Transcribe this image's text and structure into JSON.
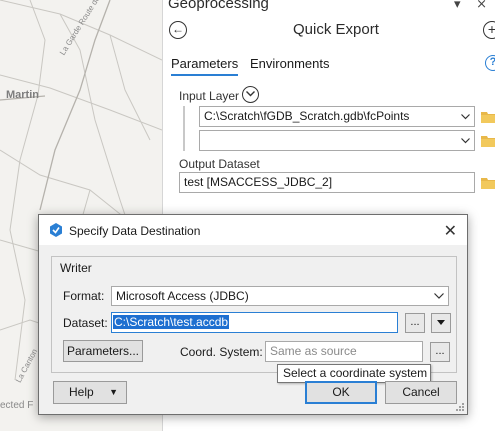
{
  "map": {
    "labels": {
      "martin": "Martin",
      "road_top": "La Garde Route de Ro",
      "road_bottom": "La Canton",
      "attribution": "ected F"
    }
  },
  "geoprocessing": {
    "pane_title": "Geoprocessing",
    "pane_controls": "▾ ⨯",
    "tool_title": "Quick Export",
    "tabs": [
      "Parameters",
      "Environments"
    ],
    "active_tab": "Parameters",
    "input_layer": {
      "label": "Input Layer",
      "rows": [
        "C:\\Scratch\\fGDB_Scratch.gdb\\fcPoints",
        ""
      ]
    },
    "output_dataset": {
      "label": "Output Dataset",
      "value": "test [MSACCESS_JDBC_2]"
    }
  },
  "dialog": {
    "title": "Specify Data Destination",
    "group_label": "Writer",
    "format": {
      "label": "Format:",
      "value": "Microsoft Access (JDBC)"
    },
    "dataset": {
      "label": "Dataset:",
      "value": "C:\\Scratch\\test.accdb",
      "browse": "..."
    },
    "parameters_button": "Parameters...",
    "coord_system": {
      "label": "Coord. System:",
      "placeholder": "Same as source",
      "browse": "..."
    },
    "tooltip": "Select a coordinate system",
    "buttons": {
      "help": "Help",
      "ok": "OK",
      "cancel": "Cancel"
    }
  },
  "colors": {
    "accent": "#2a7fd4",
    "selection": "#1e6fd0",
    "folder": "#e8b84a",
    "dialog_bg": "#f0f0f0"
  },
  "icons": [
    "back-icon",
    "add-icon",
    "help-icon",
    "chevron-down-icon",
    "folder-icon",
    "app-icon",
    "close-icon",
    "resize-grip-icon"
  ]
}
